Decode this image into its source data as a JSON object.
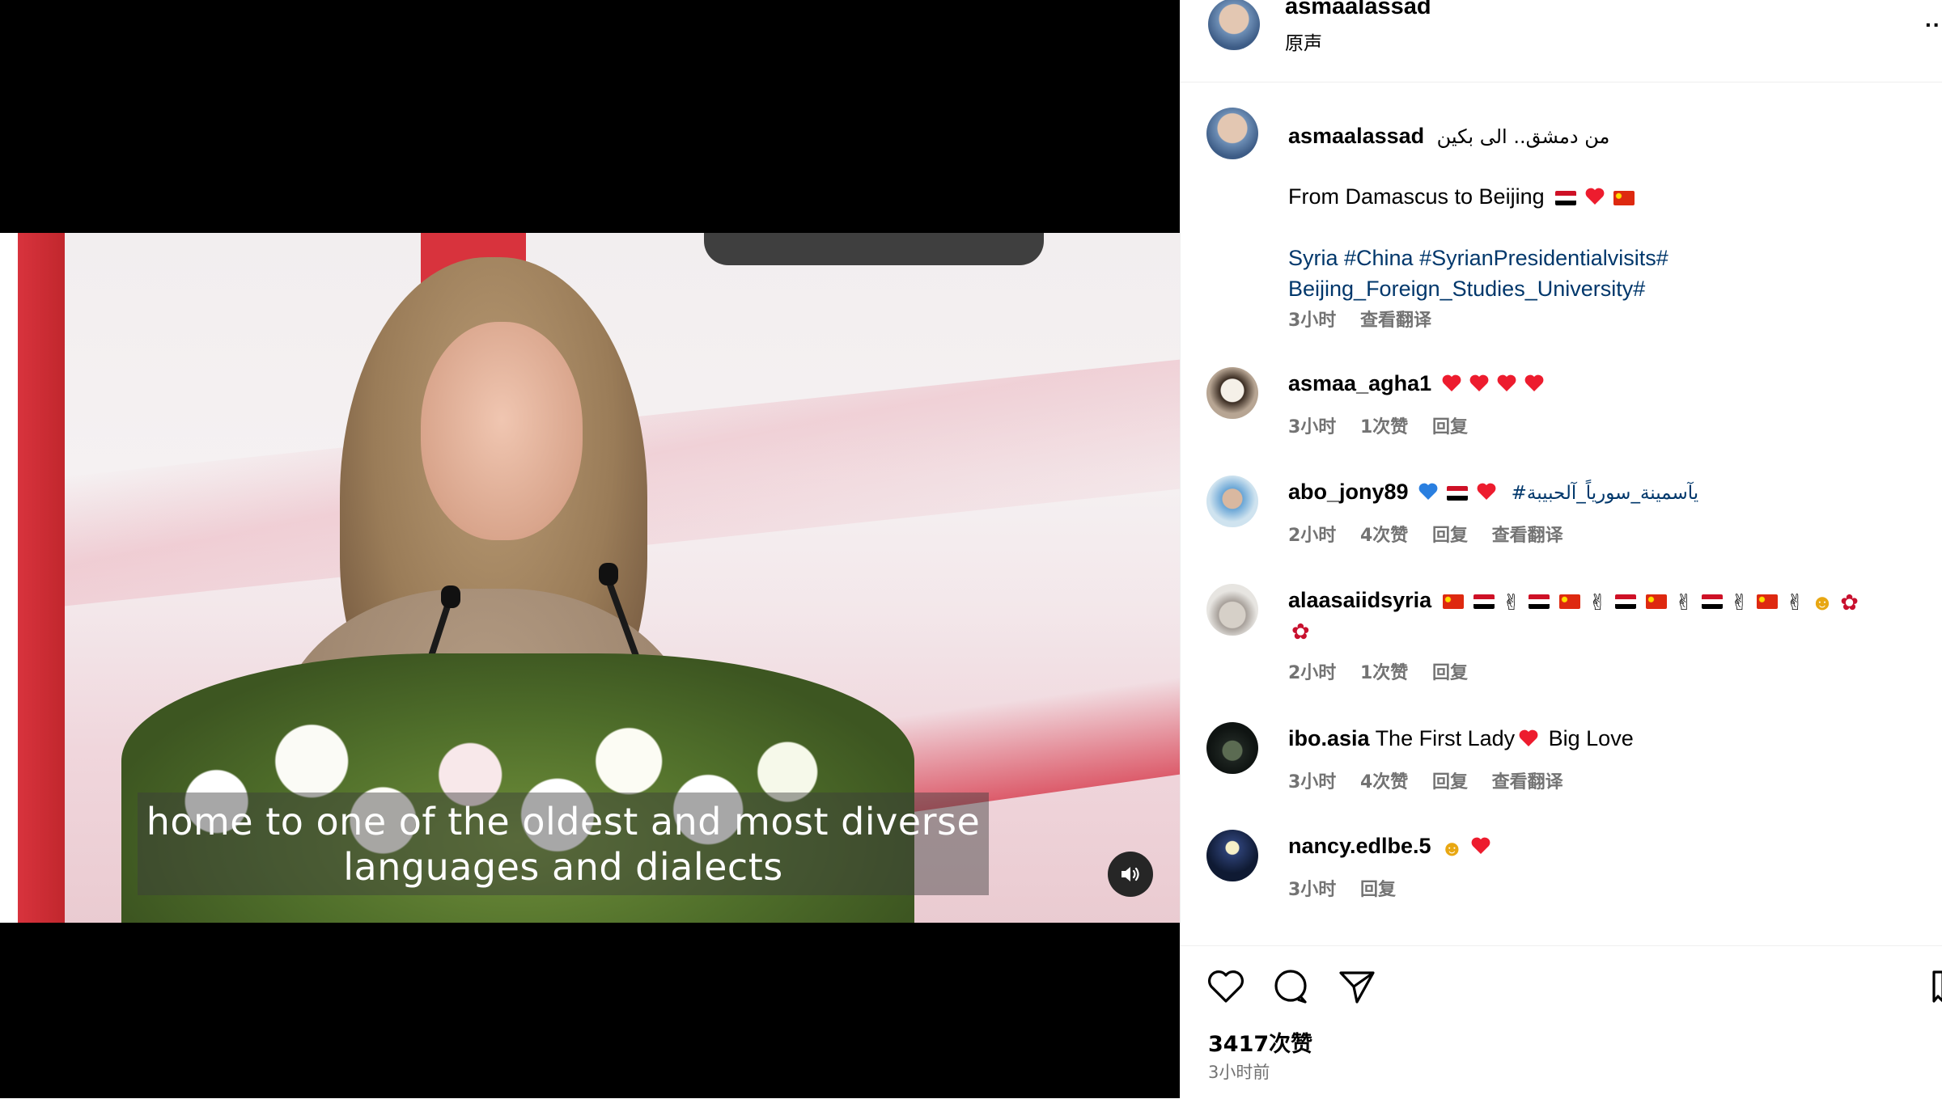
{
  "video": {
    "subtitle_line1": "home to one of the oldest and most diverse",
    "subtitle_line2": "languages and dialects",
    "mute_icon": "speaker-icon"
  },
  "header": {
    "username": "asmaalassad",
    "audio_label": "原声",
    "more_label": "..."
  },
  "caption": {
    "username": "asmaalassad",
    "arabic_text": "من دمشق.. الى بكين",
    "english_text": "From Damascus to Beijing",
    "hashtags_line1": "Syria #China #SyrianPresidentialvisits#",
    "hashtags_line2": "Beijing_Foreign_Studies_University#",
    "time": "3小时",
    "translate": "查看翻译"
  },
  "comments": [
    {
      "username": "asmaa_agha1",
      "time": "3小时",
      "likes": "1次赞",
      "reply": "回复"
    },
    {
      "username": "abo_jony89",
      "hashtag": "#يآسمينة_سورياً_آلحبيبة",
      "time": "2小时",
      "likes": "4次赞",
      "reply": "回复",
      "translate": "查看翻译"
    },
    {
      "username": "alaasaiidsyria",
      "time": "2小时",
      "likes": "1次赞",
      "reply": "回复"
    },
    {
      "username": "ibo.asia",
      "text_a": "The First Lady",
      "text_b": "Big Love",
      "time": "3小时",
      "likes": "4次赞",
      "reply": "回复",
      "translate": "查看翻译"
    },
    {
      "username": "nancy.edlbe.5",
      "time": "3小时",
      "reply": "回复"
    }
  ],
  "actions": {
    "likes_count": "3417次赞",
    "post_time": "3小时前"
  },
  "colors": {
    "link_blue": "#00376b",
    "meta_gray": "#737373",
    "heart_red": "#ed1c2e",
    "divider": "#efefef"
  }
}
